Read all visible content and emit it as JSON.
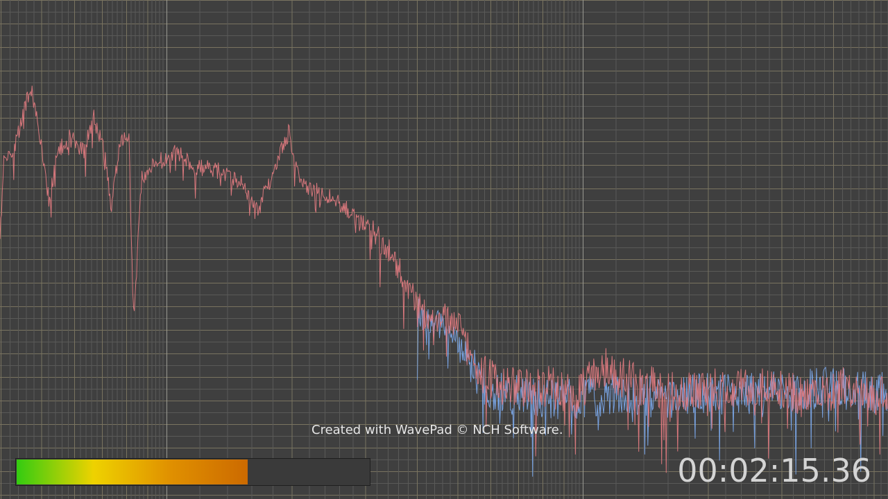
{
  "app": {
    "name": "WavePad",
    "watermark": "Created with WavePad © NCH Software."
  },
  "playback": {
    "timecode": "00:02:15.36"
  },
  "level_meter": {
    "level_fraction": 0.655,
    "gradient_colors": [
      "#33cc11",
      "#eed200",
      "#e09000",
      "#cc6a00"
    ]
  },
  "colors": {
    "background": "#3f3f3f",
    "grid_minor": "#5a5a58",
    "grid_major": "#7a7460",
    "grid_bright": "#9a9a92",
    "left_channel": "#e07a80",
    "right_channel": "#7aa6e8"
  },
  "chart_data": {
    "type": "line",
    "x_scale": "log",
    "grid": true,
    "series": [
      {
        "channel": "left",
        "color": "#e07a80",
        "shape": [
          [
            0.0,
            0.47
          ],
          [
            0.005,
            0.3
          ],
          [
            0.012,
            0.32
          ],
          [
            0.02,
            0.27
          ],
          [
            0.03,
            0.2
          ],
          [
            0.036,
            0.18
          ],
          [
            0.045,
            0.27
          ],
          [
            0.055,
            0.4
          ],
          [
            0.065,
            0.3
          ],
          [
            0.08,
            0.27
          ],
          [
            0.095,
            0.3
          ],
          [
            0.105,
            0.23
          ],
          [
            0.118,
            0.3
          ],
          [
            0.125,
            0.42
          ],
          [
            0.135,
            0.28
          ],
          [
            0.145,
            0.26
          ],
          [
            0.15,
            0.63
          ],
          [
            0.16,
            0.35
          ],
          [
            0.18,
            0.32
          ],
          [
            0.2,
            0.3
          ],
          [
            0.22,
            0.33
          ],
          [
            0.25,
            0.34
          ],
          [
            0.27,
            0.36
          ],
          [
            0.29,
            0.42
          ],
          [
            0.31,
            0.33
          ],
          [
            0.325,
            0.26
          ],
          [
            0.34,
            0.37
          ],
          [
            0.36,
            0.38
          ],
          [
            0.38,
            0.4
          ],
          [
            0.4,
            0.43
          ],
          [
            0.42,
            0.46
          ],
          [
            0.44,
            0.5
          ],
          [
            0.455,
            0.56
          ],
          [
            0.47,
            0.6
          ],
          [
            0.485,
            0.64
          ],
          [
            0.5,
            0.63
          ],
          [
            0.515,
            0.64
          ],
          [
            0.53,
            0.7
          ],
          [
            0.545,
            0.74
          ],
          [
            0.56,
            0.76
          ],
          [
            0.58,
            0.77
          ],
          [
            0.6,
            0.76
          ],
          [
            0.65,
            0.78
          ],
          [
            0.68,
            0.73
          ],
          [
            0.72,
            0.76
          ],
          [
            0.76,
            0.78
          ],
          [
            0.8,
            0.77
          ],
          [
            0.85,
            0.77
          ],
          [
            0.9,
            0.78
          ],
          [
            0.95,
            0.77
          ],
          [
            1.0,
            0.79
          ]
        ]
      },
      {
        "channel": "right",
        "color": "#7aa6e8",
        "shape": [
          [
            0.47,
            0.62
          ],
          [
            0.5,
            0.65
          ],
          [
            0.53,
            0.72
          ],
          [
            0.545,
            0.77
          ],
          [
            0.56,
            0.78
          ],
          [
            0.6,
            0.79
          ],
          [
            0.65,
            0.79
          ],
          [
            0.7,
            0.78
          ],
          [
            0.75,
            0.79
          ],
          [
            0.8,
            0.78
          ],
          [
            0.85,
            0.78
          ],
          [
            0.9,
            0.77
          ],
          [
            0.95,
            0.77
          ],
          [
            1.0,
            0.78
          ]
        ]
      }
    ]
  }
}
